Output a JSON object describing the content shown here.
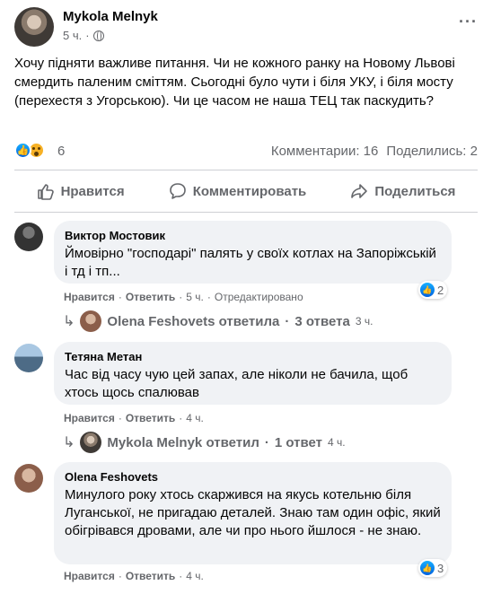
{
  "post": {
    "author": "Mykola Melnyk",
    "time": "5 ч.",
    "more": "···",
    "text": "Хочу підняти важливе питання. Чи не кожного ранку на Новому Львові смердить паленим сміттям. Сьогодні було чути і біля УКУ, і біля мосту (перехестя з Угорською). Чи це часом не наша ТЕЦ так паскудить?",
    "reactions_count": "6",
    "comments_stat": "Комментарии: 16",
    "shares_stat": "Поделились: 2",
    "like_emoji": "👍"
  },
  "actions": {
    "like": "Нравится",
    "comment": "Комментировать",
    "share": "Поделиться"
  },
  "comments": [
    {
      "name": "Виктор Мостовик",
      "text": "Ймовірно \"господарі\" палять у своїх котлах на Запоріжській і тд і тп...",
      "like": "Нравится",
      "reply": "Ответить",
      "time": "5 ч.",
      "edited": "Отредактировано",
      "reactions": "2",
      "reply_summary": {
        "name": "Olena Feshovets ответила",
        "count": "3 ответа",
        "time": "3 ч."
      }
    },
    {
      "name": "Тетяна Метан",
      "text": "Час від часу чую цей запах, але ніколи не бачила, щоб хтось щось спалював",
      "like": "Нравится",
      "reply": "Ответить",
      "time": "4 ч.",
      "reply_summary": {
        "name": "Mykola Melnyk ответил",
        "count": "1 ответ",
        "time": "4 ч."
      }
    },
    {
      "name": "Olena Feshovets",
      "text": "Минулого року хтось скаржився на якусь котельню біля Луганської, не пригадаю деталей. Знаю там один офіс, який обігрівався дровами, але чи про нього йшлося - не знаю.",
      "like": "Нравится",
      "reply": "Ответить",
      "time": "4 ч.",
      "reactions": "3"
    }
  ],
  "separators": {
    "dot": "·"
  },
  "icons": {
    "globe": "globe-icon",
    "like": "thumbs-up-icon",
    "comment": "speech-bubble-icon",
    "share": "share-arrow-icon",
    "reply_arrow": "reply-arrow-icon"
  },
  "colors": {
    "accent": "#1877f2",
    "secondary_text": "#65676b",
    "bubble": "#f0f2f5",
    "divider": "#ced0d4"
  }
}
